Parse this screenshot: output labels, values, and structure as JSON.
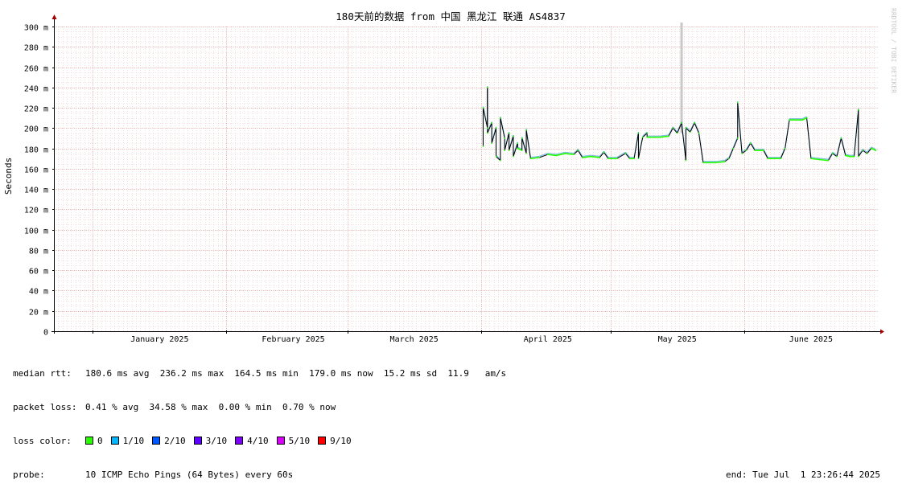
{
  "chart_data": {
    "type": "line",
    "title": "180天前的数据 from 中国 黑龙江 联通 AS4837",
    "ylabel": "Seconds",
    "y_ticks": [
      "0",
      "20 m",
      "40 m",
      "60 m",
      "80 m",
      "100 m",
      "120 m",
      "140 m",
      "160 m",
      "180 m",
      "200 m",
      "220 m",
      "240 m",
      "260 m",
      "280 m",
      "300 m"
    ],
    "ylim_ms": [
      0,
      300
    ],
    "x_range": [
      "2024-12-23",
      "2025-07-01"
    ],
    "x_ticks": [
      {
        "label": "January 2025",
        "date": "2025-01-01"
      },
      {
        "label": "February 2025",
        "date": "2025-02-01"
      },
      {
        "label": "March 2025",
        "date": "2025-03-01"
      },
      {
        "label": "April 2025",
        "date": "2025-04-01"
      },
      {
        "label": "May 2025",
        "date": "2025-05-01"
      },
      {
        "label": "June 2025",
        "date": "2025-06-01"
      }
    ],
    "grid": true,
    "series": [
      {
        "values_ms": [
          [
            "2025-04-01",
            182
          ],
          [
            "2025-04-01",
            220
          ],
          [
            "2025-04-02",
            200
          ],
          [
            "2025-04-02",
            240
          ],
          [
            "2025-04-02",
            195
          ],
          [
            "2025-04-03",
            205
          ],
          [
            "2025-04-03",
            185
          ],
          [
            "2025-04-04",
            200
          ],
          [
            "2025-04-04",
            172
          ],
          [
            "2025-04-05",
            168
          ],
          [
            "2025-04-05",
            210
          ],
          [
            "2025-04-06",
            190
          ],
          [
            "2025-04-06",
            178
          ],
          [
            "2025-04-07",
            195
          ],
          [
            "2025-04-07",
            178
          ],
          [
            "2025-04-08",
            192
          ],
          [
            "2025-04-08",
            172
          ],
          [
            "2025-04-09",
            185
          ],
          [
            "2025-04-09",
            180
          ],
          [
            "2025-04-10",
            178
          ],
          [
            "2025-04-10",
            190
          ],
          [
            "2025-04-11",
            175
          ],
          [
            "2025-04-11",
            198
          ],
          [
            "2025-04-12",
            170
          ],
          [
            "2025-04-14",
            171
          ],
          [
            "2025-04-16",
            174
          ],
          [
            "2025-04-18",
            173
          ],
          [
            "2025-04-20",
            175
          ],
          [
            "2025-04-22",
            174
          ],
          [
            "2025-04-23",
            178
          ],
          [
            "2025-04-24",
            171
          ],
          [
            "2025-04-26",
            172
          ],
          [
            "2025-04-28",
            171
          ],
          [
            "2025-04-29",
            176
          ],
          [
            "2025-04-30",
            170
          ],
          [
            "2025-05-02",
            170
          ],
          [
            "2025-05-04",
            175
          ],
          [
            "2025-05-05",
            170
          ],
          [
            "2025-05-06",
            170
          ],
          [
            "2025-05-07",
            195
          ],
          [
            "2025-05-07",
            170
          ],
          [
            "2025-05-08",
            191
          ],
          [
            "2025-05-09",
            195
          ],
          [
            "2025-05-09",
            191
          ],
          [
            "2025-05-12",
            191
          ],
          [
            "2025-05-14",
            192
          ],
          [
            "2025-05-15",
            200
          ],
          [
            "2025-05-16",
            195
          ],
          [
            "2025-05-17",
            205
          ],
          [
            "2025-05-18",
            168
          ],
          [
            "2025-05-18",
            200
          ],
          [
            "2025-05-19",
            196
          ],
          [
            "2025-05-20",
            205
          ],
          [
            "2025-05-21",
            195
          ],
          [
            "2025-05-22",
            166
          ],
          [
            "2025-05-25",
            166
          ],
          [
            "2025-05-27",
            167
          ],
          [
            "2025-05-28",
            170
          ],
          [
            "2025-05-29",
            180
          ],
          [
            "2025-05-30",
            190
          ],
          [
            "2025-05-30",
            225
          ],
          [
            "2025-05-31",
            175
          ],
          [
            "2025-06-01",
            178
          ],
          [
            "2025-06-02",
            185
          ],
          [
            "2025-06-03",
            178
          ],
          [
            "2025-06-05",
            178
          ],
          [
            "2025-06-06",
            170
          ],
          [
            "2025-06-09",
            170
          ],
          [
            "2025-06-10",
            180
          ],
          [
            "2025-06-11",
            208
          ],
          [
            "2025-06-14",
            208
          ],
          [
            "2025-06-15",
            210
          ],
          [
            "2025-06-16",
            170
          ],
          [
            "2025-06-18",
            169
          ],
          [
            "2025-06-20",
            168
          ],
          [
            "2025-06-21",
            175
          ],
          [
            "2025-06-22",
            172
          ],
          [
            "2025-06-23",
            190
          ],
          [
            "2025-06-24",
            173
          ],
          [
            "2025-06-25",
            172
          ],
          [
            "2025-06-26",
            172
          ],
          [
            "2025-06-27",
            218
          ],
          [
            "2025-06-27",
            172
          ],
          [
            "2025-06-28",
            178
          ],
          [
            "2025-06-29",
            175
          ],
          [
            "2025-06-30",
            180
          ],
          [
            "2025-07-01",
            178
          ]
        ]
      }
    ],
    "gap_marker_date": "2025-05-17"
  },
  "side_label": "RRDTOOL / TOBI OETIKER",
  "legend": {
    "median_rtt_label": "median rtt:",
    "median_rtt_value": "180.6 ms avg  236.2 ms max  164.5 ms min  179.0 ms now  15.2 ms sd  11.9   am/s",
    "packet_loss_label": "packet loss:",
    "packet_loss_value": "0.41 % avg  34.58 % max  0.00 % min  0.70 % now",
    "loss_color_label": "loss color:",
    "loss_colors": [
      {
        "label": "0",
        "color": "#26ff00"
      },
      {
        "label": "1/10",
        "color": "#00b8ff"
      },
      {
        "label": "2/10",
        "color": "#0059ff"
      },
      {
        "label": "3/10",
        "color": "#5e00ff"
      },
      {
        "label": "4/10",
        "color": "#7e00ff"
      },
      {
        "label": "5/10",
        "color": "#dd00ff"
      },
      {
        "label": "9/10",
        "color": "#ff0000"
      }
    ],
    "probe_label": "probe:",
    "probe_value": "10 ICMP Echo Pings (64 Bytes) every 60s",
    "end_text": "end: Tue Jul  1 23:26:44 2025"
  },
  "colors": {
    "grid_minor": "#e8c8c8",
    "grid_major": "#e0a0a0",
    "axis": "#000000",
    "arrow": "#a00000",
    "median": "#000000",
    "smoke": "#1e90c8",
    "gap": "#c8c8c8"
  }
}
